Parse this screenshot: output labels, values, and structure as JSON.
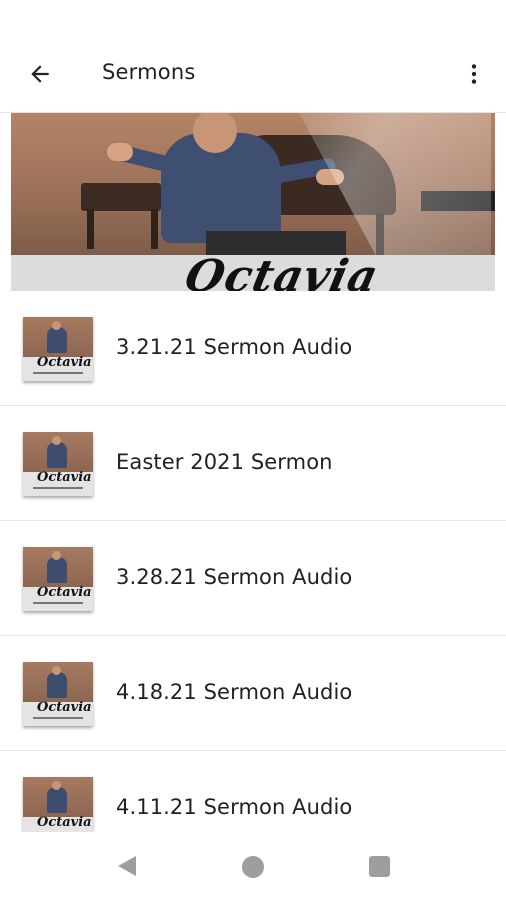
{
  "app_bar": {
    "title": "Sermons",
    "back_icon": "arrow-left-icon",
    "menu_icon": "more-vert-icon"
  },
  "hero": {
    "script_text": "Octavia"
  },
  "sermons": [
    {
      "title": "3.21.21 Sermon Audio"
    },
    {
      "title": "Easter 2021 Sermon"
    },
    {
      "title": "3.28.21 Sermon Audio"
    },
    {
      "title": "4.18.21 Sermon Audio"
    },
    {
      "title": "4.11.21 Sermon Audio"
    }
  ],
  "thumbnail": {
    "script_text": "Octavia"
  },
  "nav": {
    "back_icon": "triangle-back-icon",
    "home_icon": "circle-home-icon",
    "recents_icon": "square-recents-icon"
  },
  "colors": {
    "text_primary": "#212121",
    "divider": "#e6e6e6",
    "nav_icon": "#9e9e9e"
  }
}
